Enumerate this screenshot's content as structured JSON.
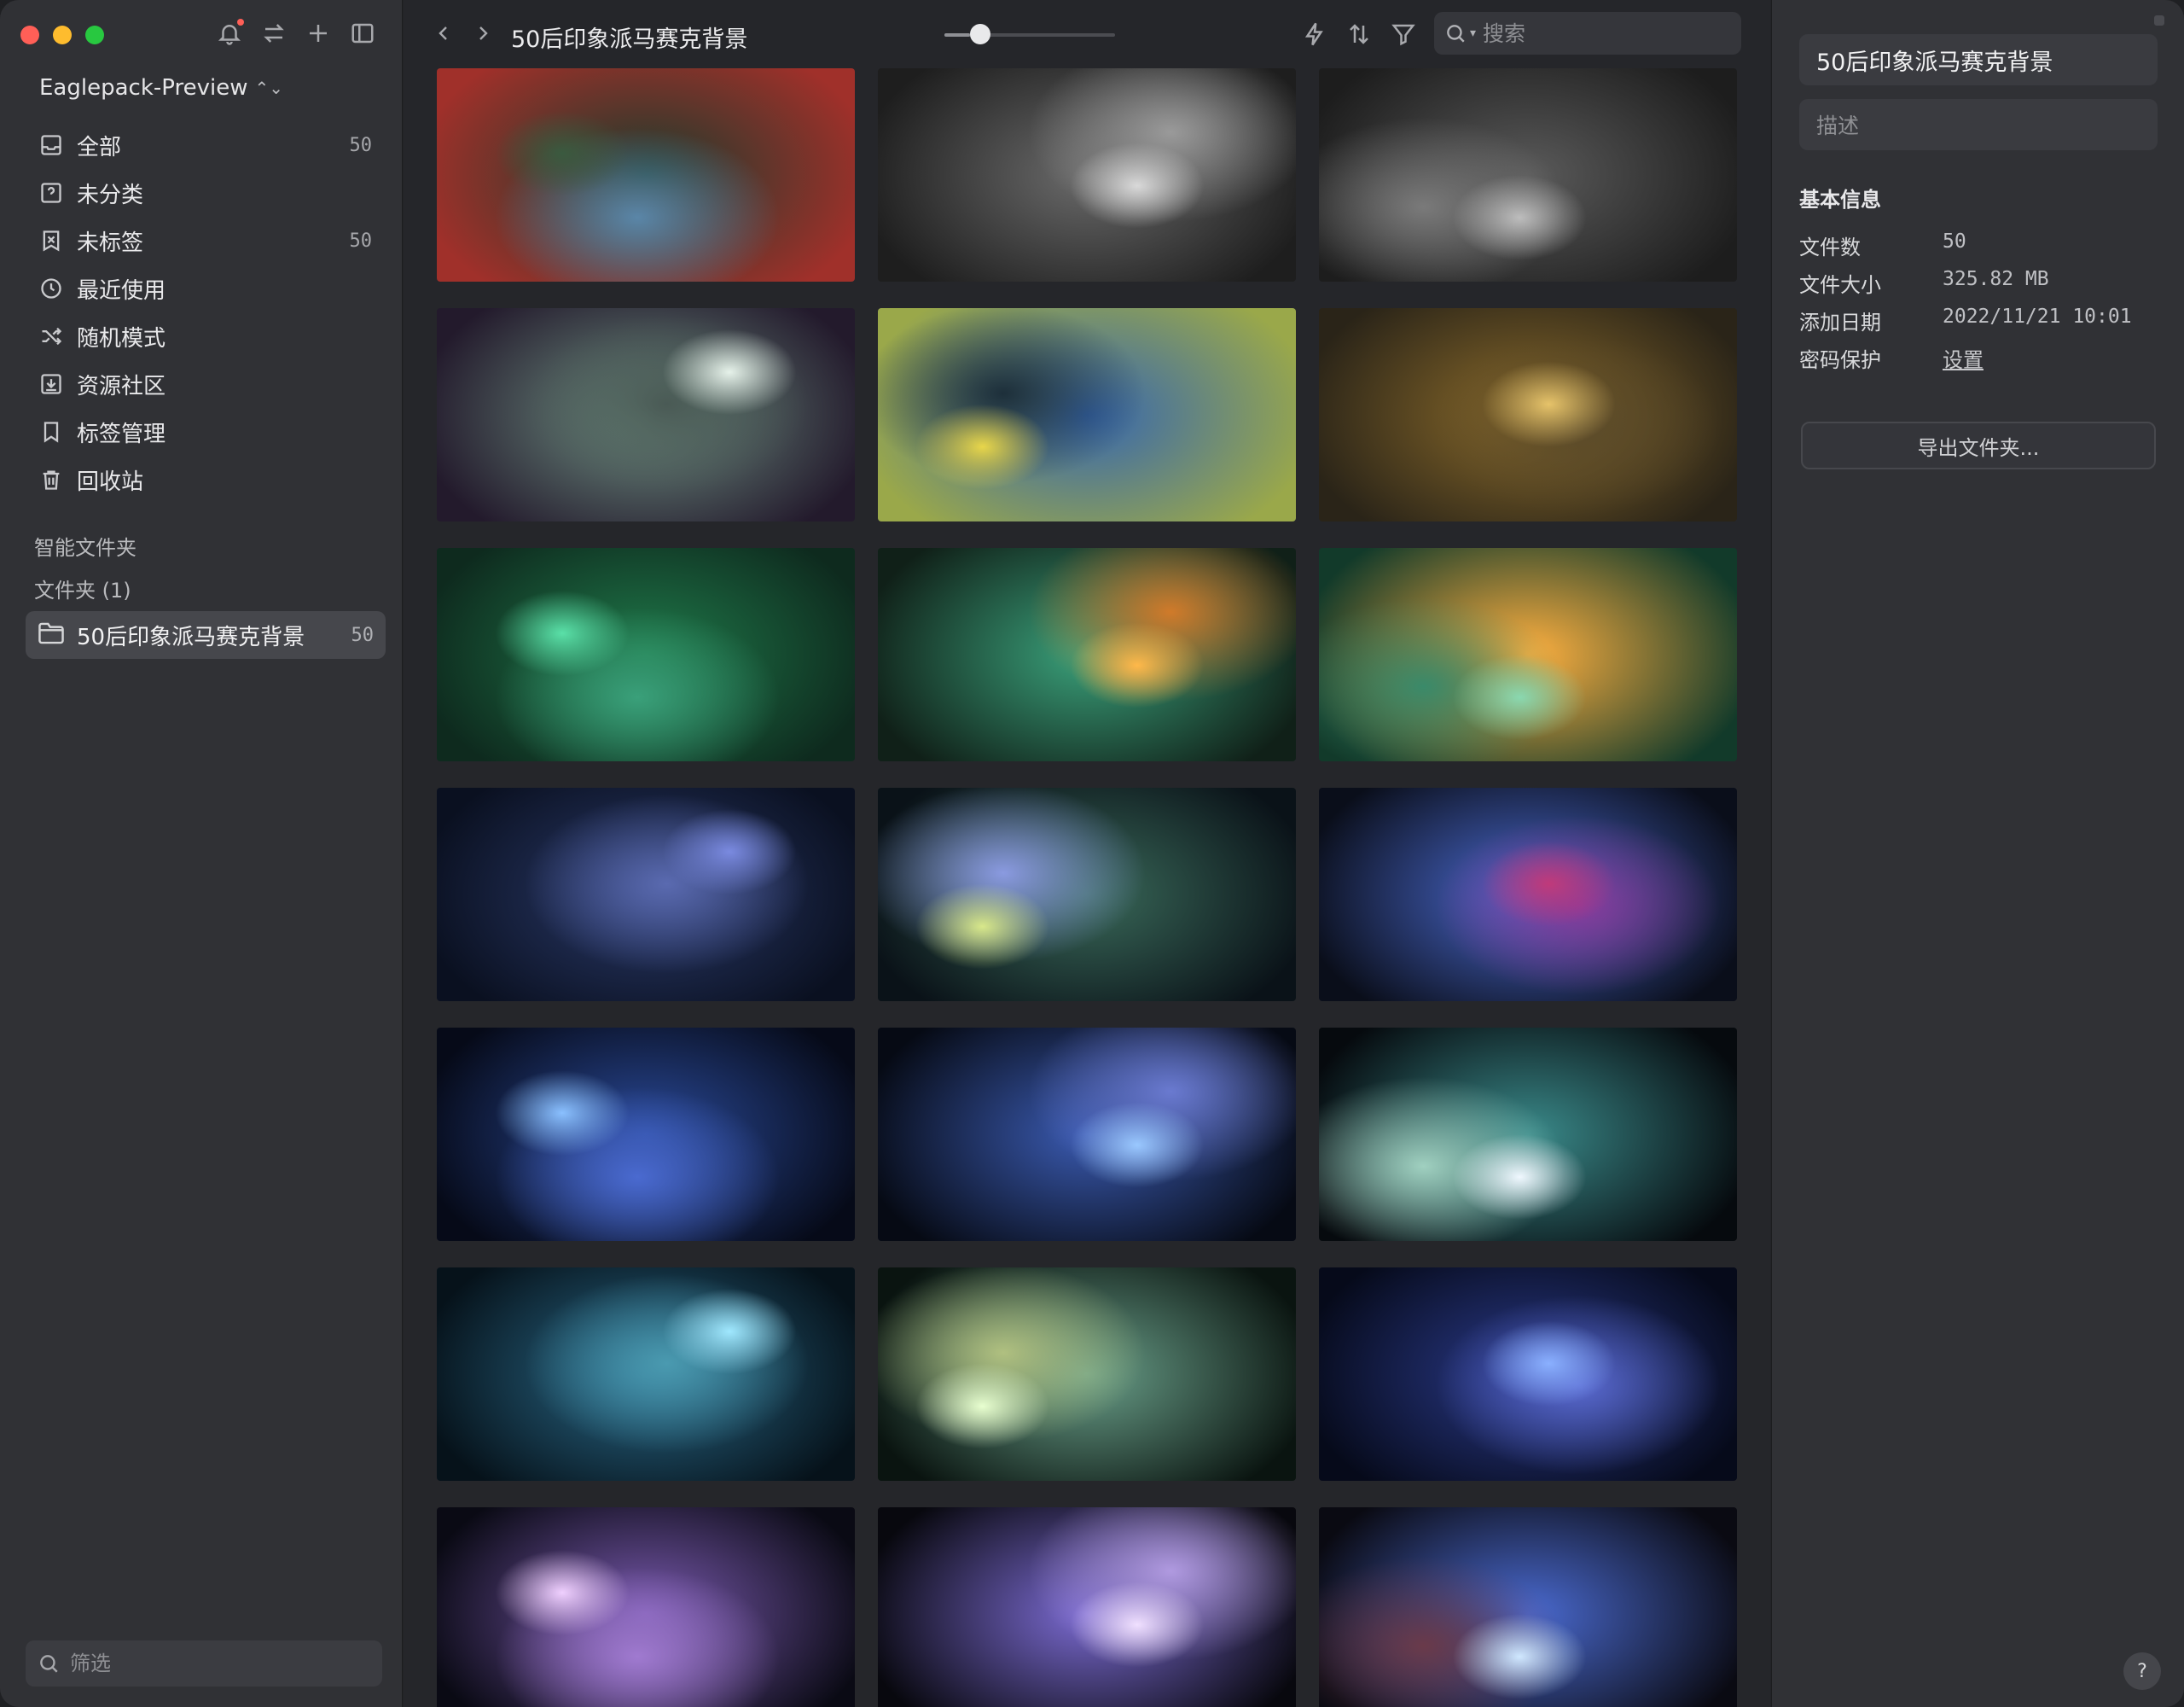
{
  "window": {
    "library_name": "Eaglepack-Preview"
  },
  "sidebar": {
    "items": [
      {
        "name": "all",
        "label": "全部",
        "count": "50",
        "icon": "inbox-icon"
      },
      {
        "name": "uncategorized",
        "label": "未分类",
        "count": "",
        "icon": "question-box-icon"
      },
      {
        "name": "untagged",
        "label": "未标签",
        "count": "50",
        "icon": "tag-off-icon"
      },
      {
        "name": "recent",
        "label": "最近使用",
        "count": "",
        "icon": "clock-icon"
      },
      {
        "name": "random",
        "label": "随机模式",
        "count": "",
        "icon": "shuffle-icon"
      },
      {
        "name": "community",
        "label": "资源社区",
        "count": "",
        "icon": "download-box-icon"
      },
      {
        "name": "tags",
        "label": "标签管理",
        "count": "",
        "icon": "bookmark-icon"
      },
      {
        "name": "trash",
        "label": "回收站",
        "count": "",
        "icon": "trash-icon"
      }
    ],
    "smart_folders_label": "智能文件夹",
    "folders_label": "文件夹 (1)",
    "folder": {
      "label": "50后印象派马赛克背景",
      "count": "50"
    },
    "filter_placeholder": "筛选"
  },
  "toolbar": {
    "title": "50后印象派马赛克背景",
    "zoom_level": 0.15,
    "search_placeholder": "搜索"
  },
  "grid": {
    "thumbnails": [
      {
        "name": "thumb-1",
        "colors": [
          "#3a5a3f",
          "#1c3b2c",
          "#a0302a",
          "#5a86a8"
        ]
      },
      {
        "name": "thumb-2",
        "colors": [
          "#d9d9d9",
          "#6a6a6a",
          "#1e1e1e",
          "#9a9a9a"
        ]
      },
      {
        "name": "thumb-3",
        "colors": [
          "#bdbdbd",
          "#5a5a5a",
          "#1d1d1d",
          "#7a7a7a"
        ]
      },
      {
        "name": "thumb-4",
        "colors": [
          "#e6f2ea",
          "#6f8f82",
          "#231a2c",
          "#4a5a55"
        ]
      },
      {
        "name": "thumb-5",
        "colors": [
          "#e8d64a",
          "#3566b0",
          "#9aa84a",
          "#1d2f3a"
        ]
      },
      {
        "name": "thumb-6",
        "colors": [
          "#e6c36a",
          "#8a6a2a",
          "#2a2418",
          "#5a4a2a"
        ]
      },
      {
        "name": "thumb-7",
        "colors": [
          "#5ae0a8",
          "#1f7a4a",
          "#0e2a1e",
          "#3aa07a"
        ]
      },
      {
        "name": "thumb-8",
        "colors": [
          "#ffb84a",
          "#3aa07a",
          "#102018",
          "#d07a2a"
        ]
      },
      {
        "name": "thumb-9",
        "colors": [
          "#8ad8b0",
          "#ffb040",
          "#123a2a",
          "#3a8a6a"
        ]
      },
      {
        "name": "thumb-10",
        "colors": [
          "#7a8ae0",
          "#2a3a6a",
          "#0a1020",
          "#5a6ab0"
        ]
      },
      {
        "name": "thumb-11",
        "colors": [
          "#d8e88a",
          "#3a6a5a",
          "#0a1218",
          "#8a9ae0"
        ]
      },
      {
        "name": "thumb-12",
        "colors": [
          "#c03a7a",
          "#4a6ad0",
          "#0a0e1a",
          "#8a3a9a"
        ]
      },
      {
        "name": "thumb-13",
        "colors": [
          "#8ac0ff",
          "#2a4a9a",
          "#060a18",
          "#4a6ad0"
        ]
      },
      {
        "name": "thumb-14",
        "colors": [
          "#9ac8ff",
          "#3a5ab0",
          "#060a14",
          "#6a7ad0"
        ]
      },
      {
        "name": "thumb-15",
        "colors": [
          "#f0f8ff",
          "#3a8a8a",
          "#060a0e",
          "#a0d0c0"
        ]
      },
      {
        "name": "thumb-16",
        "colors": [
          "#a0e8ff",
          "#2a6a8a",
          "#06121a",
          "#4a9ab0"
        ]
      },
      {
        "name": "thumb-17",
        "colors": [
          "#e8ffd0",
          "#6aa08a",
          "#0a1410",
          "#b0c080"
        ]
      },
      {
        "name": "thumb-18",
        "colors": [
          "#8ab0ff",
          "#2a3a8a",
          "#060a1a",
          "#5a6ad0"
        ]
      },
      {
        "name": "thumb-19",
        "colors": [
          "#f0d0ff",
          "#7a5ab0",
          "#0a0a14",
          "#a07ad0"
        ]
      },
      {
        "name": "thumb-20",
        "colors": [
          "#f0e0ff",
          "#7a6ad0",
          "#08080e",
          "#b09ae0"
        ]
      },
      {
        "name": "thumb-21",
        "colors": [
          "#d0e8ff",
          "#4a6ad0",
          "#0a0a12",
          "#6a3a4a"
        ]
      }
    ]
  },
  "inspector": {
    "title": "50后印象派马赛克背景",
    "description_placeholder": "描述",
    "section_title": "基本信息",
    "rows": [
      {
        "key": "文件数",
        "value": "50"
      },
      {
        "key": "文件大小",
        "value": "325.82 MB"
      },
      {
        "key": "添加日期",
        "value": "2022/11/21 10:01"
      },
      {
        "key": "密码保护",
        "value": "设置"
      }
    ],
    "export_label": "导出文件夹...",
    "help_label": "?"
  }
}
